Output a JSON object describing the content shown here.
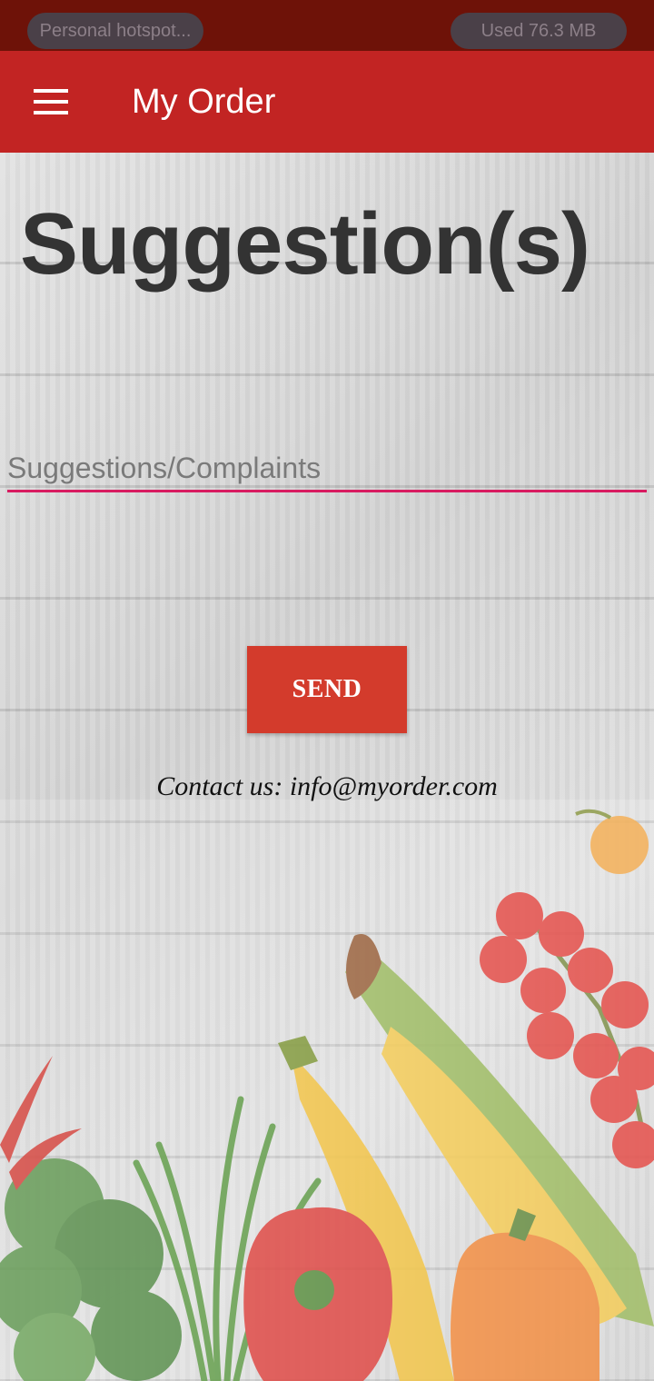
{
  "status_bar": {
    "hotspot_label": "Personal hotspot...",
    "data_usage": "Used  76.3 MB"
  },
  "app_bar": {
    "menu_icon": "hamburger-menu-icon",
    "title": "My Order"
  },
  "page": {
    "heading": "Suggestion(s)",
    "input_placeholder": "Suggestions/Complaints",
    "input_value": "",
    "send_label": "SEND",
    "contact_text": "Contact us: info@myorder.com"
  },
  "colors": {
    "status_bar": "#6e1208",
    "app_bar": "#c22423",
    "accent_underline": "#d81b60",
    "send_button": "#d33b2c"
  }
}
